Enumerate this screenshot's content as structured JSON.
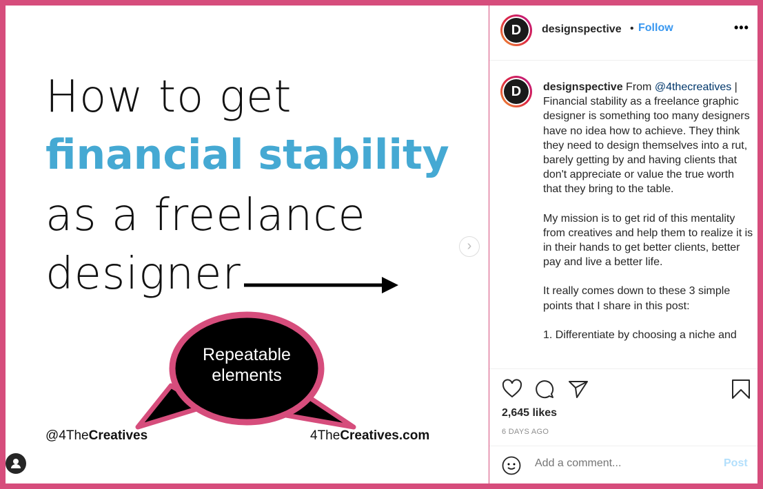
{
  "post_image": {
    "line1": "How to get",
    "line2": "financial stability",
    "line3": "as a freelance",
    "line4": "designer",
    "bubble_line1": "Repeatable",
    "bubble_line2": "elements",
    "handle_prefix": "@4The",
    "handle_bold": "Creatives",
    "site_prefix": "4The",
    "site_bold": "Creatives.com",
    "accent": "#45a9d3",
    "bubble_border": "#d64d7c"
  },
  "header": {
    "username": "designspective",
    "separator": "•",
    "follow_label": "Follow",
    "more_label": "•••",
    "avatar_letter": "D"
  },
  "caption": {
    "username": "designspective",
    "intro": " From ",
    "mention": "@4thecreatives",
    "rest": " | Financial stability as a freelance graphic designer is something too many designers have no idea how to achieve. They think they need to design themselves into a rut, barely getting by and having clients that don't appreciate or value the true worth that they bring to the table.",
    "p2": "My mission is to get rid of this mentality from creatives and help them to realize it is in their hands to get better clients, better pay and live a better life.",
    "p3": "It really comes down to these 3 simple points that I share in this post:",
    "p4": "1. Differentiate by choosing a niche and"
  },
  "engagement": {
    "likes": "2,645 likes",
    "time_ago": "6 DAYS AGO"
  },
  "comment": {
    "placeholder": "Add a comment...",
    "post_label": "Post"
  },
  "colors": {
    "frame": "#d64d7c",
    "link": "#3897f0"
  }
}
